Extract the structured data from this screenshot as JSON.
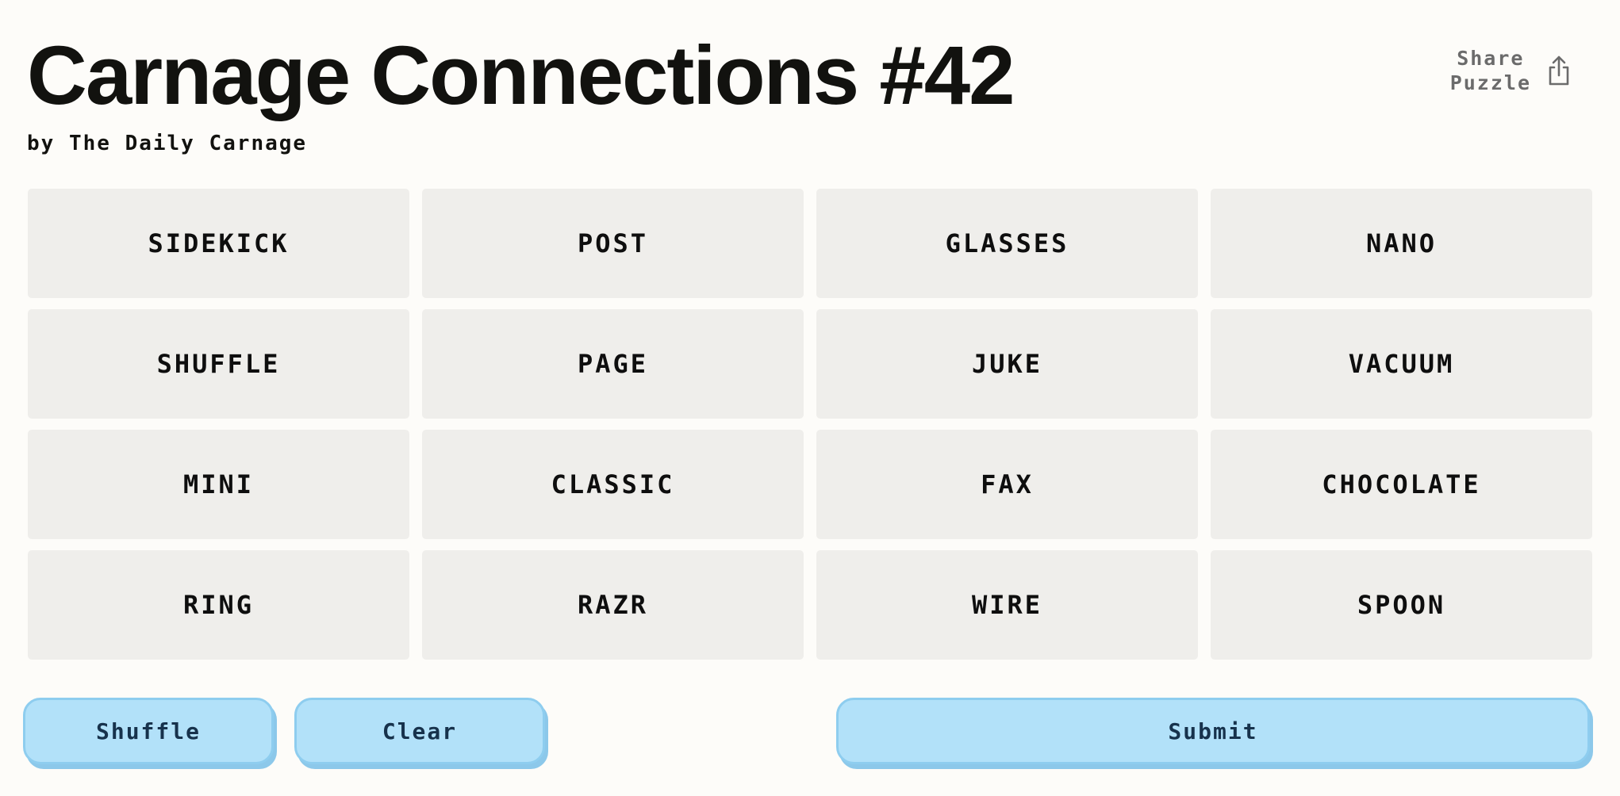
{
  "header": {
    "title": "Carnage Connections #42",
    "byline": "by The Daily Carnage",
    "share": {
      "line1": "Share",
      "line2": "Puzzle",
      "icon": "share-icon"
    }
  },
  "tiles": [
    "SIDEKICK",
    "POST",
    "GLASSES",
    "NANO",
    "SHUFFLE",
    "PAGE",
    "JUKE",
    "VACUUM",
    "MINI",
    "CLASSIC",
    "FAX",
    "CHOCOLATE",
    "RING",
    "RAZR",
    "WIRE",
    "SPOON"
  ],
  "actions": {
    "shuffle_label": "Shuffle",
    "clear_label": "Clear",
    "submit_label": "Submit"
  },
  "colors": {
    "background": "#fdfcf9",
    "tile": "#efeeeb",
    "button": "#b2e1f9",
    "button_border": "#8ecdef",
    "button_text": "#17324c"
  }
}
